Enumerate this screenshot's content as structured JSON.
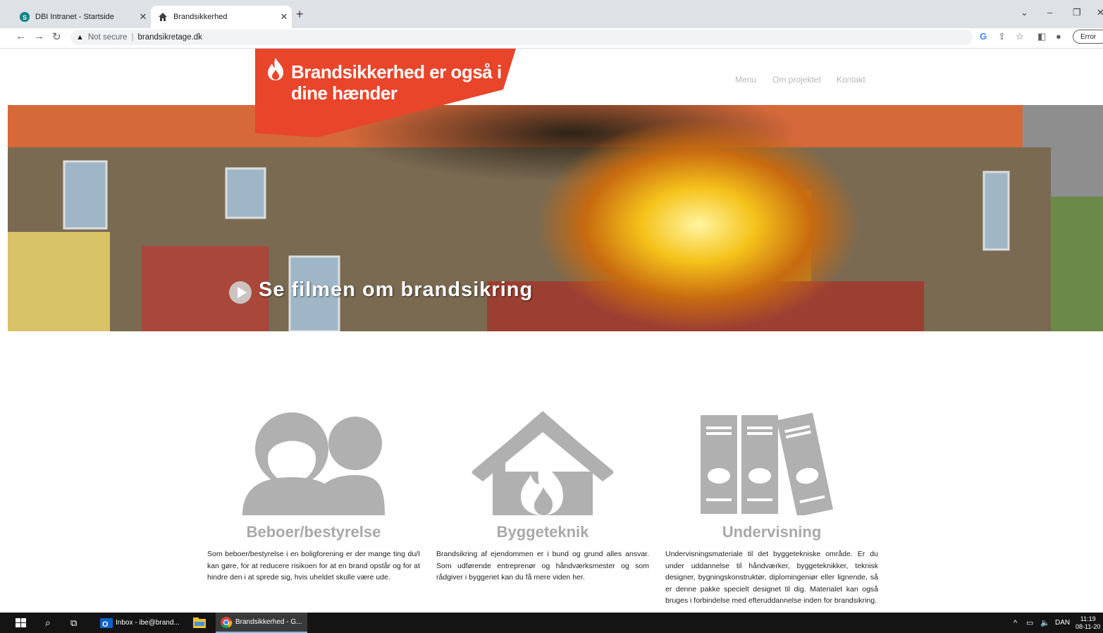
{
  "browser": {
    "tabs": [
      {
        "title": "DBI Intranet - Startside",
        "active": false
      },
      {
        "title": "Brandsikkerhed",
        "active": true
      }
    ],
    "new_tab": "+",
    "url_warning": "Not secure",
    "url": "brandsikretage.dk",
    "error_label": "Error"
  },
  "site": {
    "banner_line1": "Brandsikkerhed er også i",
    "banner_line2": "dine hænder",
    "nav": [
      "Menu",
      "Om projektet",
      "Kontakt"
    ],
    "hero_cta": "Se filmen om brandsikring",
    "accent_color": "#e8452b"
  },
  "columns": [
    {
      "title": "Beboer/bestyrelse",
      "text": "Som beboer/bestyrelse i en boligforening er der mange ting du/I kan gøre, for at reducere risikoen for at en brand opstår og for at hindre den i at sprede sig, hvis uheldet skulle være ude.",
      "icon": "residents-icon"
    },
    {
      "title": "Byggeteknik",
      "text": "Brandsikring af ejendommen er i bund og grund alles ansvar. Som udførende entreprenør og håndværksmester og som rådgiver i byggeriet kan du få mere viden her.",
      "icon": "house-fire-icon"
    },
    {
      "title": "Undervisning",
      "text": "Undervisningsmateriale til det byggetekniske område. Er du under uddannelse til håndværker, byggeteknikker, teknisk designer, bygningskonstruktør, diplomingeniør eller lignende, så er denne pakke specielt designet til dig. Materialet kan også bruges i forbindelse med efteruddannelse inden for brandsikring.",
      "icon": "binders-icon"
    }
  ],
  "taskbar": {
    "apps": [
      "Inbox - ibe@brand...",
      "Brandsikkerhed - G..."
    ],
    "lang": "DAN",
    "time": "11:19",
    "date": "08-11-20"
  }
}
